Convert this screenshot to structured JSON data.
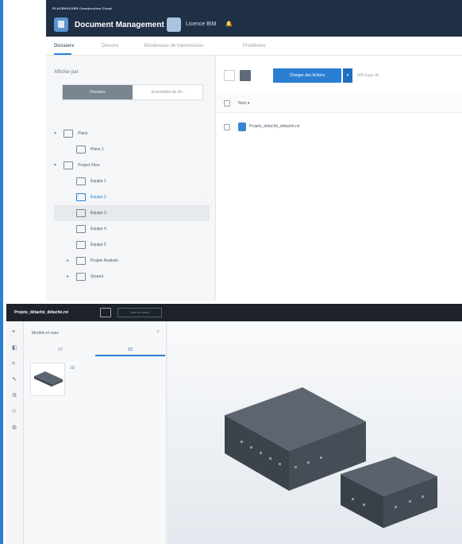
{
  "header": {
    "brand": "PLACEHOLDER Construction Cloud",
    "app_title": "Document Management",
    "app_title_arrow": "⌄",
    "project_label": "Licence BIM",
    "bell": "🔔"
  },
  "tabs": [
    {
      "label": "Dossiers"
    },
    {
      "label": "Dessins"
    },
    {
      "label": "Bordereaux de transmission"
    },
    {
      "label": "Problèmes"
    }
  ],
  "left_panel": {
    "show_by": "Afficher par",
    "segment_a": "Dossiers",
    "segment_b": "Ensembles de do...",
    "tree": [
      {
        "label": "Plans",
        "caret": "▾"
      },
      {
        "label": "Plans 1",
        "caret": ""
      },
      {
        "label": "Project Files",
        "caret": "▾"
      },
      {
        "label": "Équipe 1",
        "caret": ""
      },
      {
        "label": "Équipe 2",
        "caret": "",
        "more": "⋯"
      },
      {
        "label": "Équipe 3",
        "caret": ""
      },
      {
        "label": "Équipe 4",
        "caret": ""
      },
      {
        "label": "Équipe 5",
        "caret": ""
      },
      {
        "label": "Projets finalisés",
        "caret": "▸"
      },
      {
        "label": "Shared",
        "caret": "▸"
      }
    ]
  },
  "right_panel": {
    "upload_label": "Charger des fichiers",
    "upload_dd": "▾",
    "display_label": "Affichage de",
    "col_name": "Nom ▾",
    "file_name": "Projets_détaché_détaché.rvt"
  },
  "viewer": {
    "title": "Projets_détaché_détaché.rvt",
    "btn2": "Vue en cours",
    "panel_title": "Modèle et vues",
    "panel_close": "×",
    "ptab_2d": "2D",
    "ptab_3d": "3D",
    "thumb_label": "3D"
  },
  "colors": {
    "brand_dark": "#1f2f45",
    "accent": "#2a7fd4",
    "model_top": "#5d6670",
    "model_side": "#3b434b"
  }
}
